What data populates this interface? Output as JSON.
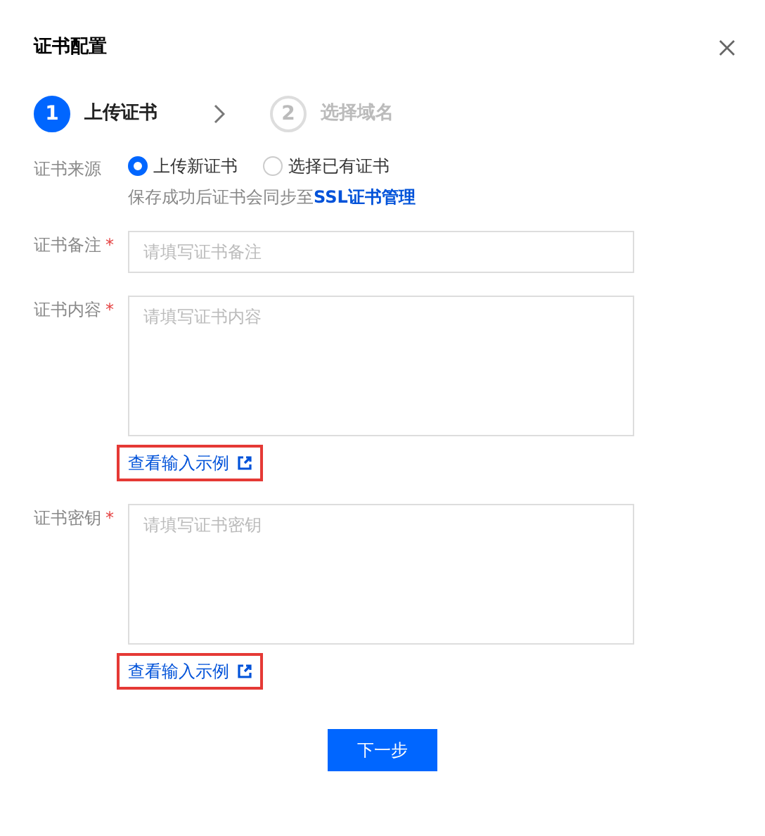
{
  "dialog": {
    "title": "证书配置"
  },
  "steps": [
    {
      "number": "1",
      "label": "上传证书",
      "selected": true
    },
    {
      "number": "2",
      "label": "选择域名",
      "selected": false
    }
  ],
  "source": {
    "label": "证书来源",
    "options": [
      {
        "label": "上传新证书",
        "selected": true
      },
      {
        "label": "选择已有证书",
        "selected": false
      }
    ],
    "hint": "保存成功后证书会同步至",
    "hint_link": "SSL证书管理"
  },
  "fields": [
    {
      "kind": "input",
      "label": "证书备注",
      "required_mark": "*",
      "placeholder": "请填写证书备注"
    },
    {
      "kind": "textarea",
      "label": "证书内容",
      "required_mark": "*",
      "placeholder": "请填写证书内容",
      "example_link": {
        "text": "查看输入示例",
        "highlighted": true
      }
    },
    {
      "kind": "textarea",
      "label": "证书密钥",
      "required_mark": "*",
      "placeholder": "请填写证书密钥",
      "example_link": {
        "text": "查看输入示例",
        "highlighted": true
      }
    }
  ],
  "next_button": "下一步"
}
